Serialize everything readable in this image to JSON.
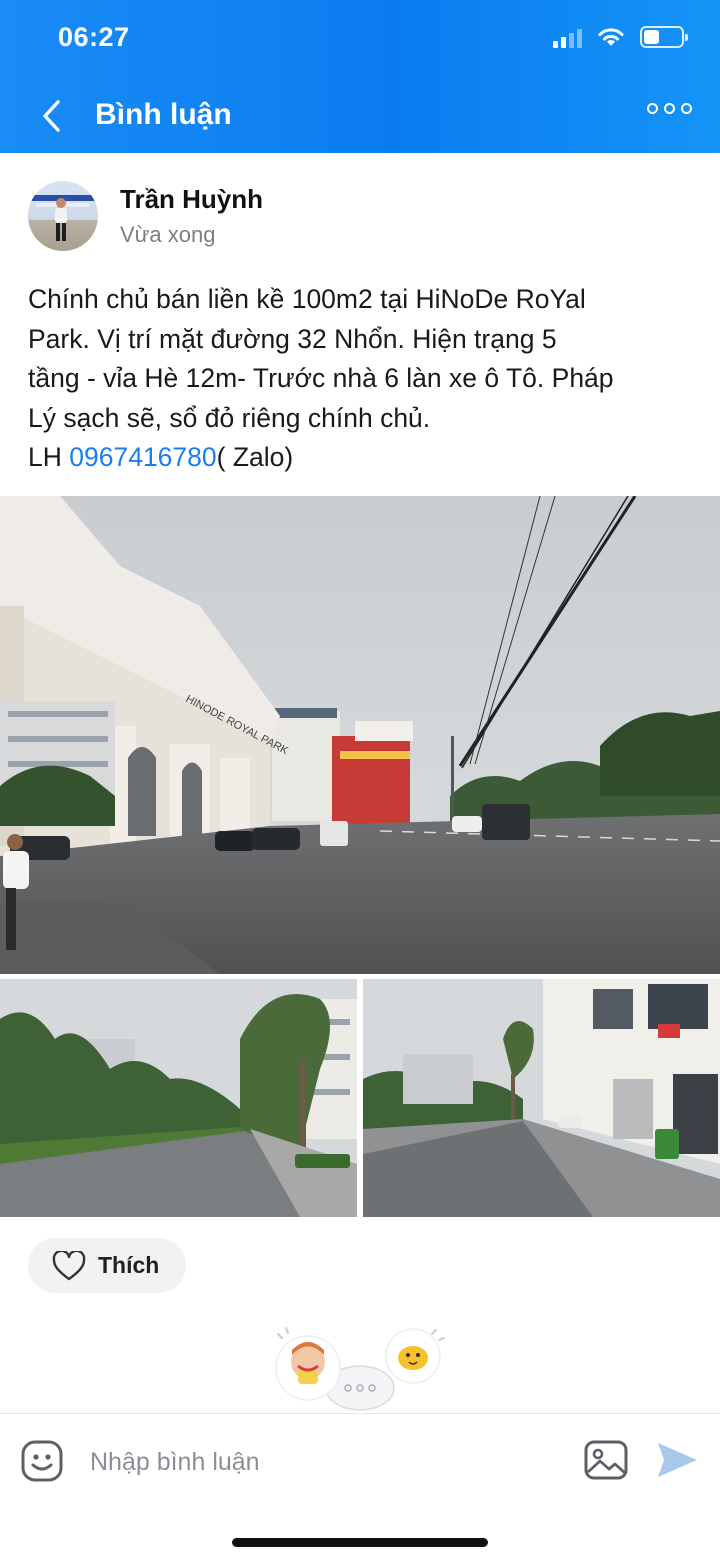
{
  "status_bar": {
    "time": "06:27",
    "icons": [
      "signal-icon",
      "wifi-icon",
      "battery-icon"
    ]
  },
  "header": {
    "title": "Bình luận",
    "back_icon": "chevron-left-icon",
    "more_icon": "more-horizontal-icon",
    "background": "#0a7cf0"
  },
  "post": {
    "author": "Trần Huỳnh",
    "time": "Vừa xong",
    "text_lines": [
      "Chính chủ bán liền kề 100m2 tại HiNoDe RoYal",
      "Park. Vị trí mặt đường 32 Nhổn. Hiện trạng 5",
      "tầng - vỉa Hè 12m- Trước nhà 6 làn xe ô Tô. Pháp",
      "Lý sạch sẽ, sổ đỏ riêng chính chủ."
    ],
    "contact_prefix": "LH ",
    "phone": "0967416780",
    "contact_suffix": "( Zalo)",
    "photos": [
      "main-street-photo",
      "street-left-photo",
      "street-right-photo"
    ],
    "building_sign": "HINODE ROYAL PARK",
    "link_color": "#1a7ef2"
  },
  "actions": {
    "like_label": "Thích",
    "like_icon": "heart-icon"
  },
  "comment_bar": {
    "placeholder": "Nhập bình luận",
    "emoji_icon": "emoji-icon",
    "image_icon": "image-icon",
    "send_icon": "send-icon"
  }
}
